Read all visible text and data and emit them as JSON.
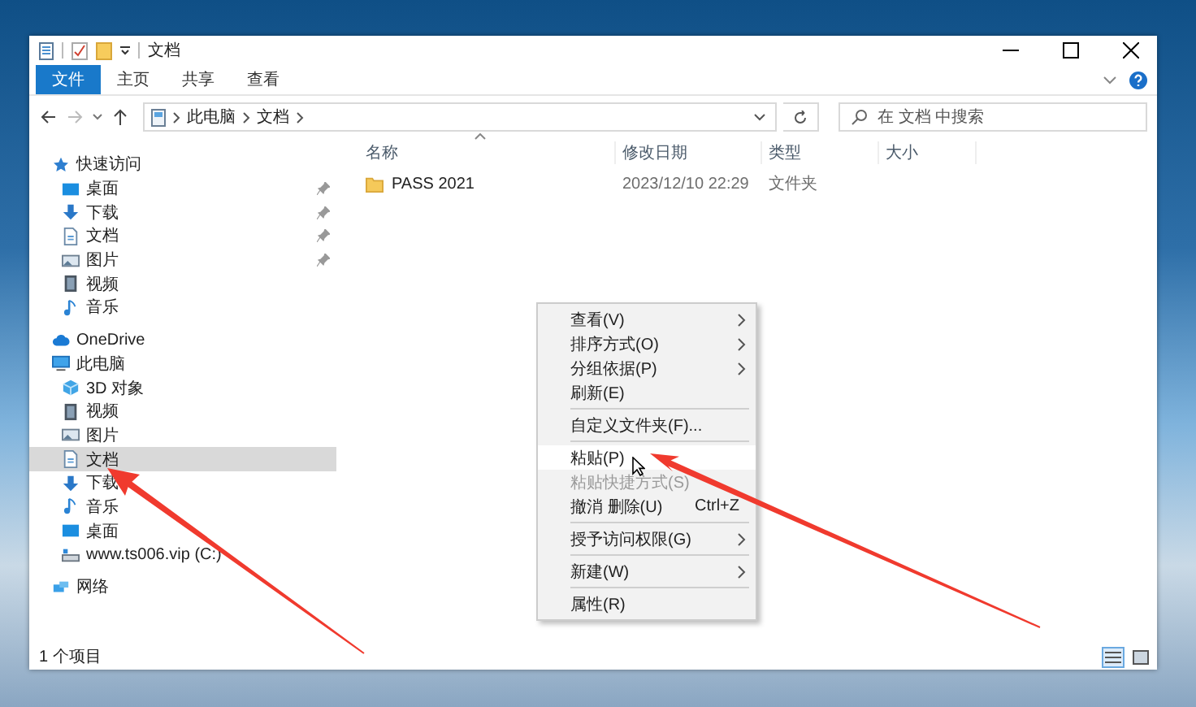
{
  "window": {
    "title": "文档"
  },
  "ribbon_tabs": [
    {
      "label": "文件",
      "kind": "file"
    },
    {
      "label": "主页",
      "kind": "tab"
    },
    {
      "label": "共享",
      "kind": "tab"
    },
    {
      "label": "查看",
      "kind": "tab"
    }
  ],
  "address_bar": {
    "crumbs": [
      "此电脑",
      "文档"
    ]
  },
  "search": {
    "placeholder": "在 文档 中搜索"
  },
  "navigation": [
    {
      "label": "快速访问",
      "kind": "star",
      "selected": false,
      "children": [
        {
          "label": "桌面",
          "kind": "desktop",
          "selected": false,
          "pinned": true
        },
        {
          "label": "下载",
          "kind": "download",
          "selected": false,
          "pinned": true
        },
        {
          "label": "文档",
          "kind": "document",
          "selected": false,
          "pinned": true
        },
        {
          "label": "图片",
          "kind": "picture",
          "selected": false,
          "pinned": true
        },
        {
          "label": "视频",
          "kind": "video",
          "selected": false,
          "pinned": false
        },
        {
          "label": "音乐",
          "kind": "music",
          "selected": false,
          "pinned": false
        }
      ]
    },
    {
      "label": "OneDrive",
      "kind": "cloud",
      "selected": false
    },
    {
      "label": "此电脑",
      "kind": "pc",
      "selected": false,
      "children": [
        {
          "label": "3D 对象",
          "kind": "cube",
          "selected": false
        },
        {
          "label": "视频",
          "kind": "video",
          "selected": false
        },
        {
          "label": "图片",
          "kind": "picture",
          "selected": false
        },
        {
          "label": "文档",
          "kind": "document",
          "selected": true
        },
        {
          "label": "下载",
          "kind": "download",
          "selected": false
        },
        {
          "label": "音乐",
          "kind": "music",
          "selected": false
        },
        {
          "label": "桌面",
          "kind": "desktop",
          "selected": false
        },
        {
          "label": "www.ts006.vip (C:)",
          "kind": "drive",
          "selected": false
        }
      ]
    },
    {
      "label": "网络",
      "kind": "network",
      "selected": false
    }
  ],
  "table": {
    "columns": [
      "名称",
      "修改日期",
      "类型",
      "大小"
    ],
    "rows": [
      {
        "name": "PASS 2021",
        "modified": "2023/12/10 22:29",
        "type": "文件夹"
      }
    ]
  },
  "context_menu": [
    {
      "kind": "item",
      "label": "查看(V)",
      "submenu": true,
      "disabled": false,
      "selected": false
    },
    {
      "kind": "item",
      "label": "排序方式(O)",
      "submenu": true,
      "disabled": false,
      "selected": false
    },
    {
      "kind": "item",
      "label": "分组依据(P)",
      "submenu": true,
      "disabled": false,
      "selected": false
    },
    {
      "kind": "item",
      "label": "刷新(E)",
      "submenu": false,
      "disabled": false,
      "selected": false
    },
    {
      "kind": "separator"
    },
    {
      "kind": "item",
      "label": "自定义文件夹(F)...",
      "submenu": false,
      "disabled": false,
      "selected": false
    },
    {
      "kind": "separator"
    },
    {
      "kind": "item",
      "label": "粘贴(P)",
      "submenu": false,
      "disabled": false,
      "selected": true
    },
    {
      "kind": "item",
      "label": "粘贴快捷方式(S)",
      "submenu": false,
      "disabled": true,
      "selected": false
    },
    {
      "kind": "item",
      "label": "撤消 删除(U)",
      "shortcut": "Ctrl+Z",
      "submenu": false,
      "disabled": false,
      "selected": false
    },
    {
      "kind": "separator"
    },
    {
      "kind": "item",
      "label": "授予访问权限(G)",
      "submenu": true,
      "disabled": false,
      "selected": false
    },
    {
      "kind": "separator"
    },
    {
      "kind": "item",
      "label": "新建(W)",
      "submenu": true,
      "disabled": false,
      "selected": false
    },
    {
      "kind": "separator"
    },
    {
      "kind": "item",
      "label": "属性(R)",
      "submenu": false,
      "disabled": false,
      "selected": false
    }
  ],
  "status_bar": {
    "text": "1 个项目",
    "views": [
      {
        "kind": "details",
        "selected": true
      },
      {
        "kind": "large-icons",
        "selected": false
      }
    ]
  }
}
